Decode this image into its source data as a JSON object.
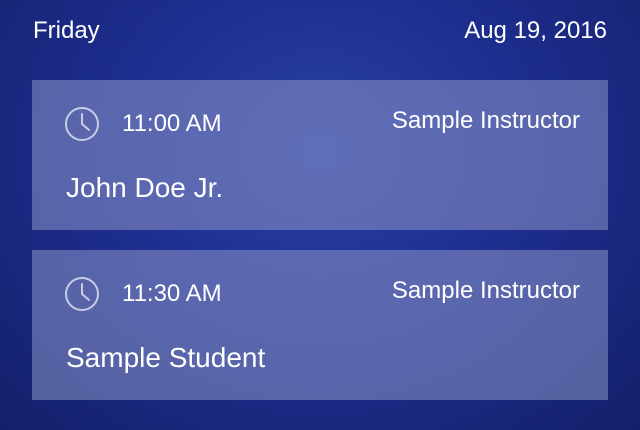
{
  "header": {
    "day": "Friday",
    "date": "Aug 19, 2016"
  },
  "appointments": [
    {
      "icon": "clock-icon",
      "time": "11:00 AM",
      "instructor": "Sample Instructor",
      "student": "John Doe Jr."
    },
    {
      "icon": "clock-icon",
      "time": "11:30 AM",
      "instructor": "Sample Instructor",
      "student": "Sample Student"
    }
  ],
  "colors": {
    "background": "#1e2e8f",
    "card": "#7d87c2",
    "text": "#ffffff",
    "icon": "#c8cce6"
  }
}
